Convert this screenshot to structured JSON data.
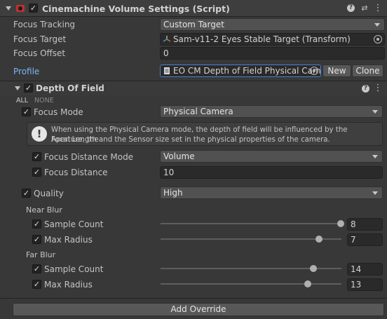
{
  "component": {
    "title": "Cinemachine Volume Settings (Script)"
  },
  "fields": {
    "focus_tracking_label": "Focus Tracking",
    "focus_tracking_value": "Custom Target",
    "focus_target_label": "Focus Target",
    "focus_target_value": "Sam-v11-2 Eyes Stable Target (Transform)",
    "focus_offset_label": "Focus Offset",
    "focus_offset_value": "0",
    "profile_label": "Profile",
    "profile_value": "EO CM Depth of Field Physical Cam",
    "new_label": "New",
    "clone_label": "Clone"
  },
  "dof": {
    "title": "Depth Of Field",
    "all_label": "ALL",
    "none_label": "NONE",
    "focus_mode_label": "Focus Mode",
    "focus_mode_value": "Physical Camera",
    "help_line1": "When using the Physical Camera mode, the depth of field will be influenced by the Aperture, the",
    "help_line2": "Focal Length and the Sensor size set in the physical properties of the camera.",
    "focus_distance_mode_label": "Focus Distance Mode",
    "focus_distance_mode_value": "Volume",
    "focus_distance_label": "Focus Distance",
    "focus_distance_value": "10",
    "quality_label": "Quality",
    "quality_value": "High",
    "near_blur_label": "Near Blur",
    "near_sample_count_label": "Sample Count",
    "near_sample_count_value": "8",
    "near_max_radius_label": "Max Radius",
    "near_max_radius_value": "7",
    "far_blur_label": "Far Blur",
    "far_sample_count_label": "Sample Count",
    "far_sample_count_value": "14",
    "far_max_radius_label": "Max Radius",
    "far_max_radius_value": "13"
  },
  "footer": {
    "add_override_label": "Add Override"
  },
  "icons": {
    "checkmark": "✓",
    "more": "⋮",
    "presets": "⇄"
  },
  "colors": {
    "background": "#383838",
    "header": "#3e3e3e",
    "link_blue": "#7ab4f5",
    "selection_outline": "#4b80d0"
  }
}
